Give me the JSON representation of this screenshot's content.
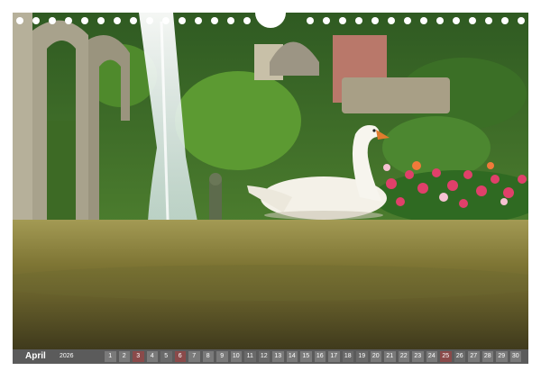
{
  "image": {
    "scene": "swan-in-garden",
    "colors": {
      "foliage": "#3f7a2c",
      "grass": "#8d8a3c",
      "swan": "#f4f1e8",
      "flowers": "#e0406a",
      "stone": "#a7a08c",
      "fountain": "#e8f2f6"
    }
  },
  "calendar": {
    "month": "April",
    "year": "2026",
    "days": [
      "1",
      "2",
      "3",
      "4",
      "5",
      "6",
      "7",
      "8",
      "9",
      "10",
      "11",
      "12",
      "13",
      "14",
      "15",
      "16",
      "17",
      "18",
      "19",
      "20",
      "21",
      "22",
      "23",
      "24",
      "25",
      "26",
      "27",
      "28",
      "29",
      "30"
    ]
  }
}
